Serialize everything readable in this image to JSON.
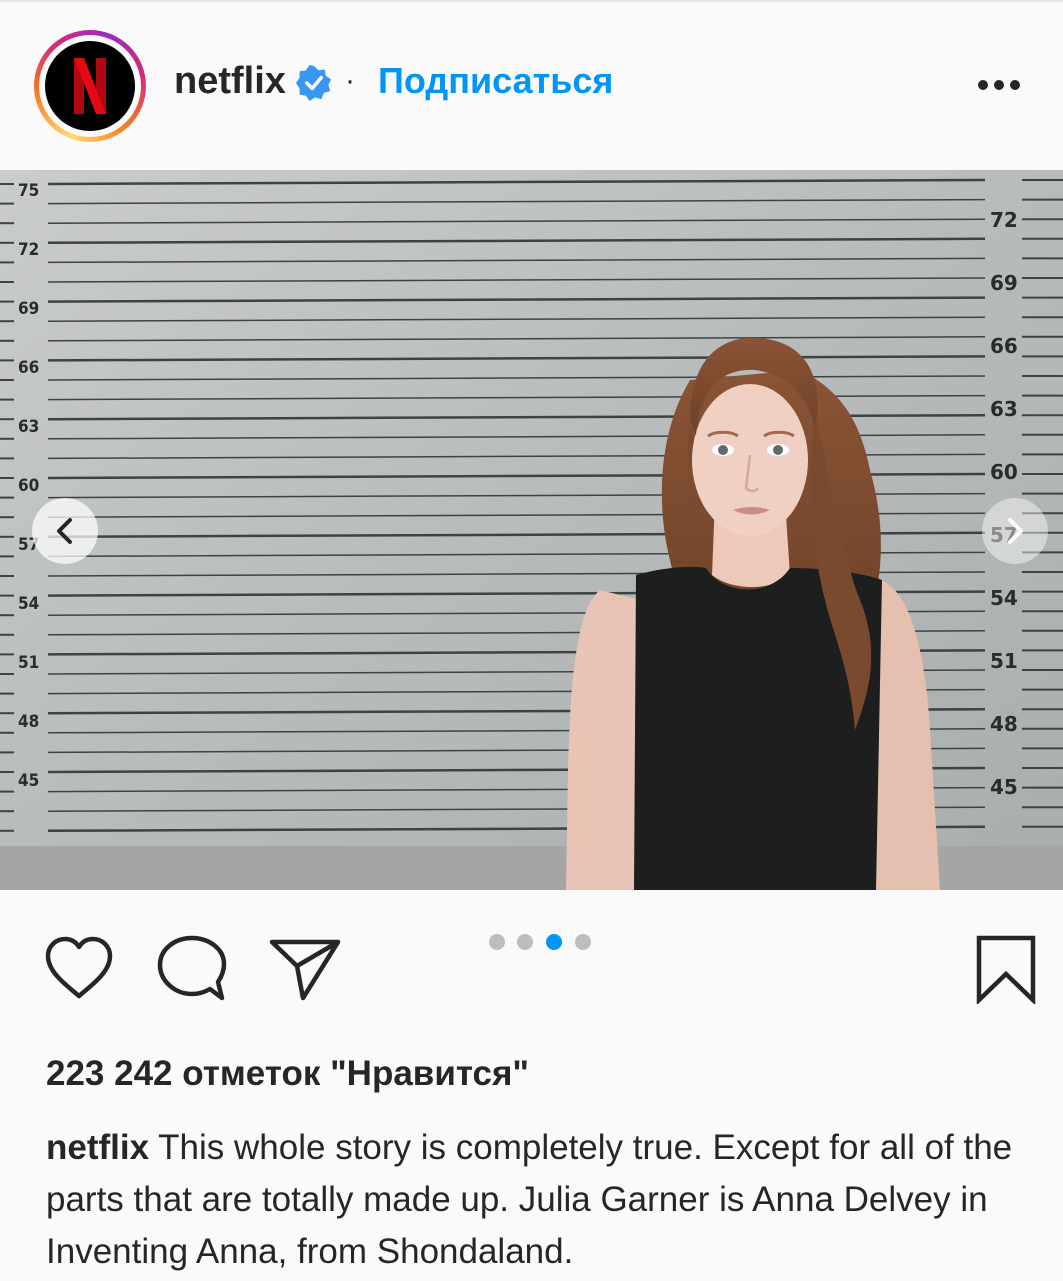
{
  "post": {
    "username": "netflix",
    "separator": "·",
    "follow_label": "Подписаться",
    "avatar_letter": "N",
    "likes_text": "223 242 отметок \"Нравится\"",
    "caption_user": "netflix",
    "caption_text": "This whole story is completely true. Except for all of the parts that are totally made up. Julia Garner is Anna Delvey in Inventing Anna, from Shondaland."
  },
  "photo": {
    "left_scale": [
      "75",
      "72",
      "69",
      "66",
      "63",
      "60",
      "57",
      "54",
      "51",
      "48",
      "45"
    ],
    "right_scale": [
      "72",
      "69",
      "66",
      "63",
      "60",
      "57",
      "54",
      "51",
      "48",
      "45"
    ]
  },
  "carousel": {
    "count": 4,
    "active_index": 2
  },
  "colors": {
    "accent": "#0095f6",
    "text": "#262626",
    "netflix_red": "#e50914"
  },
  "icons": [
    "verified-badge-icon",
    "more-options-icon",
    "chevron-left-icon",
    "chevron-right-icon",
    "heart-icon",
    "comment-icon",
    "share-icon",
    "bookmark-icon"
  ]
}
